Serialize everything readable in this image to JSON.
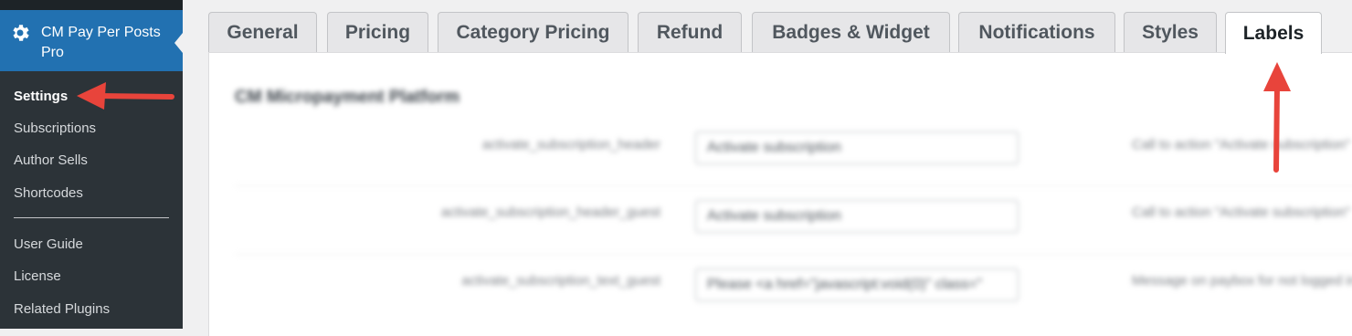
{
  "sidebar": {
    "plugin_title": "CM Pay Per Posts Pro",
    "items": [
      {
        "label": "Settings"
      },
      {
        "label": "Subscriptions"
      },
      {
        "label": "Author Sells"
      },
      {
        "label": "Shortcodes"
      },
      {
        "label": "User Guide"
      },
      {
        "label": "License"
      },
      {
        "label": "Related Plugins"
      }
    ]
  },
  "tabs": [
    {
      "label": "General"
    },
    {
      "label": "Pricing"
    },
    {
      "label": "Category Pricing"
    },
    {
      "label": "Refund"
    },
    {
      "label": "Badges & Widget"
    },
    {
      "label": "Notifications"
    },
    {
      "label": "Styles"
    },
    {
      "label": "Labels"
    }
  ],
  "active_tab": "Labels",
  "panel": {
    "section_title": "CM Micropayment Platform",
    "rows": [
      {
        "label": "activate_subscription_header",
        "value": "Activate subscription",
        "description": "Call to action \"Activate subscription\""
      },
      {
        "label": "activate_subscription_header_guest",
        "value": "Activate subscription",
        "description": "Call to action \"Activate subscription\""
      },
      {
        "label": "activate_subscription_text_guest",
        "value": "Please <a href=\"javascript:void(0)\" class=\"",
        "description": "Message on paybox for not logged in"
      }
    ]
  },
  "colors": {
    "sidebar_bg": "#2c3338",
    "sidebar_active_bg": "#2271b1",
    "arrow": "#e8443b"
  }
}
